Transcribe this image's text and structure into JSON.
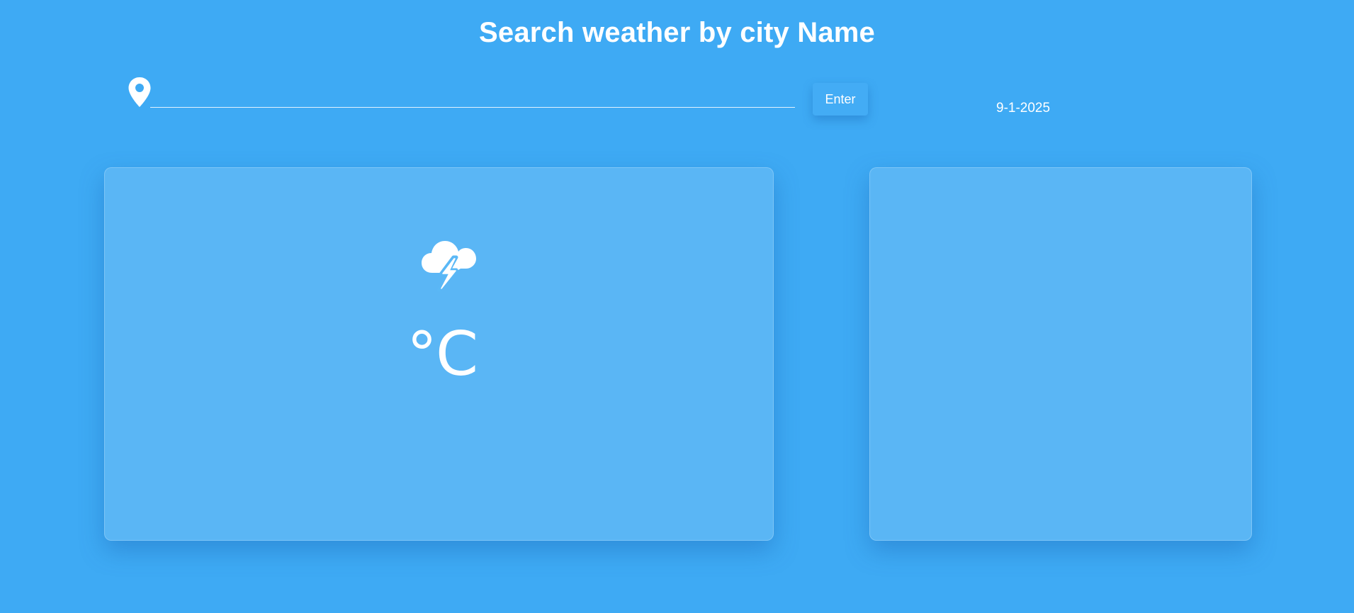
{
  "header": {
    "title": "Search weather by city Name"
  },
  "search": {
    "placeholder": "",
    "value": "",
    "icon": "location-pin-icon",
    "button_label": "Enter"
  },
  "date": "9-1-2025",
  "current_weather": {
    "icon": "thunderstorm-icon",
    "temperature_unit": "°C"
  },
  "colors": {
    "background": "#3eaaf4",
    "card": "rgba(255,255,255,0.15)",
    "text": "#ffffff",
    "button": "#43acf5"
  }
}
